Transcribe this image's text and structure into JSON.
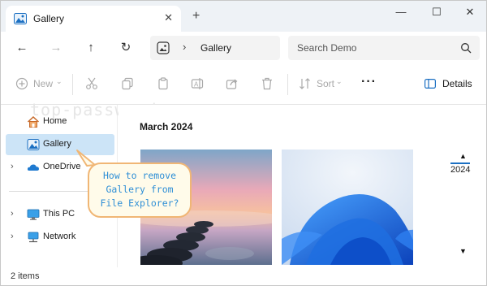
{
  "tab": {
    "title": "Gallery",
    "close": "✕",
    "new_tab": "+"
  },
  "window_controls": {
    "minimize": "—",
    "maximize": "☐",
    "close": "✕"
  },
  "nav": {
    "back": "←",
    "forward": "→",
    "up": "↑",
    "refresh": "↻"
  },
  "address": {
    "separator": "›",
    "location": "Gallery"
  },
  "search": {
    "placeholder": "Search Demo"
  },
  "toolbar": {
    "new_label": "New",
    "sort_label": "Sort",
    "more": "···",
    "details_label": "Details"
  },
  "watermark": "top-password.com",
  "sidebar": {
    "items": [
      {
        "label": "Home",
        "icon": "home-icon"
      },
      {
        "label": "Gallery",
        "icon": "gallery-icon",
        "selected": true
      },
      {
        "label": "OneDrive",
        "icon": "cloud-icon",
        "expandable": true
      },
      {
        "label": "This PC",
        "icon": "pc-icon",
        "expandable": true
      },
      {
        "label": "Network",
        "icon": "network-icon",
        "expandable": true
      }
    ],
    "chevron": "›"
  },
  "content": {
    "group_heading": "March 2024",
    "timeline_year": "2024",
    "timeline_up": "▲",
    "timeline_down": "▼",
    "thumbnails": [
      {
        "name": "sunset-rocks-photo"
      },
      {
        "name": "windows-bloom-wallpaper"
      }
    ]
  },
  "callout": {
    "text": "How to remove Gallery from File Explorer?"
  },
  "status": {
    "item_count": "2 items"
  },
  "colors": {
    "selection": "#cce4f7",
    "accent": "#1a6fc2",
    "callout_border": "#f0b675",
    "callout_text": "#2f8fd6"
  }
}
